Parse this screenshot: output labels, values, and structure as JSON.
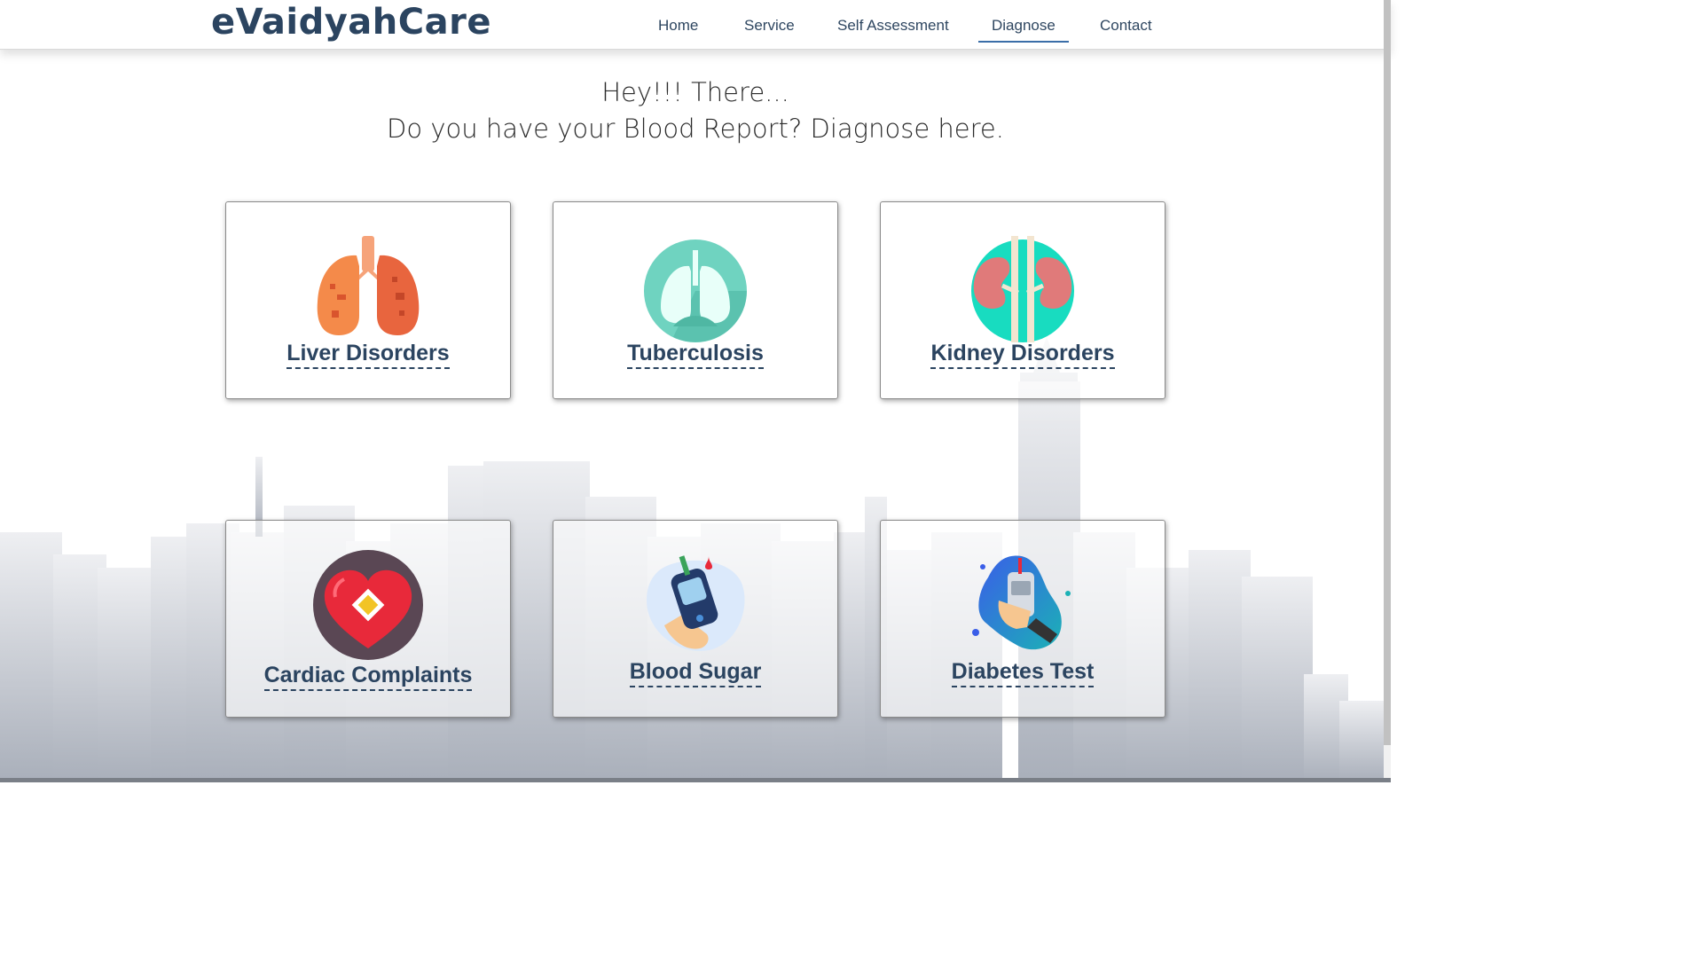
{
  "header": {
    "logo": "eVaidyahCare",
    "nav": [
      {
        "label": "Home",
        "active": false
      },
      {
        "label": "Service",
        "active": false
      },
      {
        "label": "Self Assessment",
        "active": false
      },
      {
        "label": "Diagnose",
        "active": true
      },
      {
        "label": "Contact",
        "active": false
      }
    ]
  },
  "hero": {
    "line1": "Hey!!! There...",
    "line2": "Do you have your Blood Report? Diagnose here."
  },
  "cards": [
    {
      "label": "Liver Disorders",
      "icon": "lungs-icon"
    },
    {
      "label": "Tuberculosis",
      "icon": "lungs-circle-icon"
    },
    {
      "label": "Kidney Disorders",
      "icon": "kidney-icon"
    },
    {
      "label": "Cardiac Complaints",
      "icon": "heart-icon"
    },
    {
      "label": "Blood Sugar",
      "icon": "glucometer-icon"
    },
    {
      "label": "Diabetes Test",
      "icon": "diabetes-meter-icon"
    }
  ],
  "colors": {
    "brand": "#2b4460",
    "nav_underline": "#3b6ea8"
  }
}
